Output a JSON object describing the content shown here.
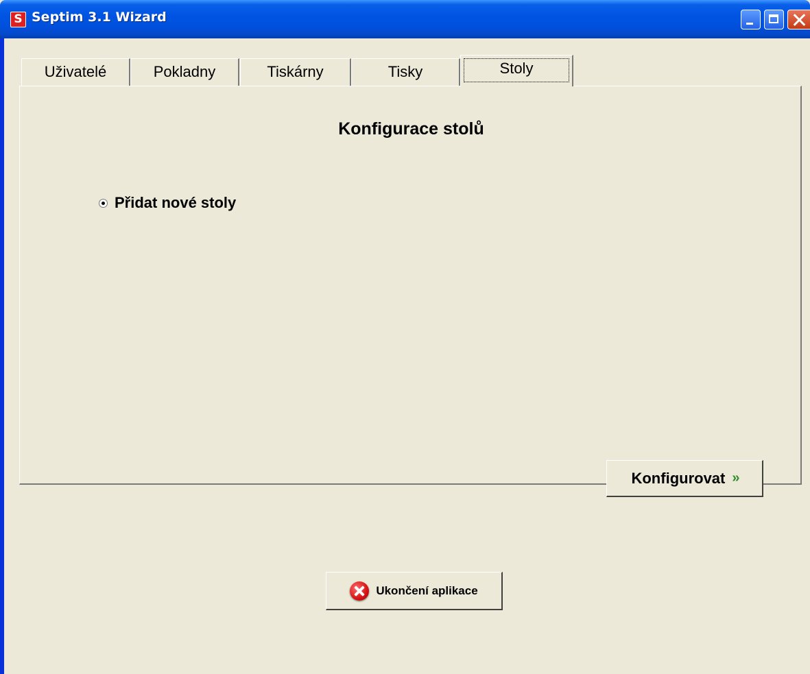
{
  "window": {
    "title": "Septim 3.1 Wizard",
    "app_icon_letter": "S"
  },
  "tabs": [
    {
      "label": "Uživatelé",
      "active": false
    },
    {
      "label": "Pokladny",
      "active": false
    },
    {
      "label": "Tiskárny",
      "active": false
    },
    {
      "label": "Tisky",
      "active": false
    },
    {
      "label": "Stoly",
      "active": true
    }
  ],
  "panel": {
    "title": "Konfigurace stolů",
    "option_label": "Přidat nové stoly",
    "option_selected": true,
    "configure_button": "Konfigurovat",
    "configure_arrows": "»"
  },
  "footer": {
    "exit_button": "Ukončení aplikace"
  },
  "colors": {
    "titlebar": "#0054e3",
    "background": "#ece9d8",
    "arrow_accent": "#2e8b2e",
    "exit_icon": "#d41414"
  }
}
